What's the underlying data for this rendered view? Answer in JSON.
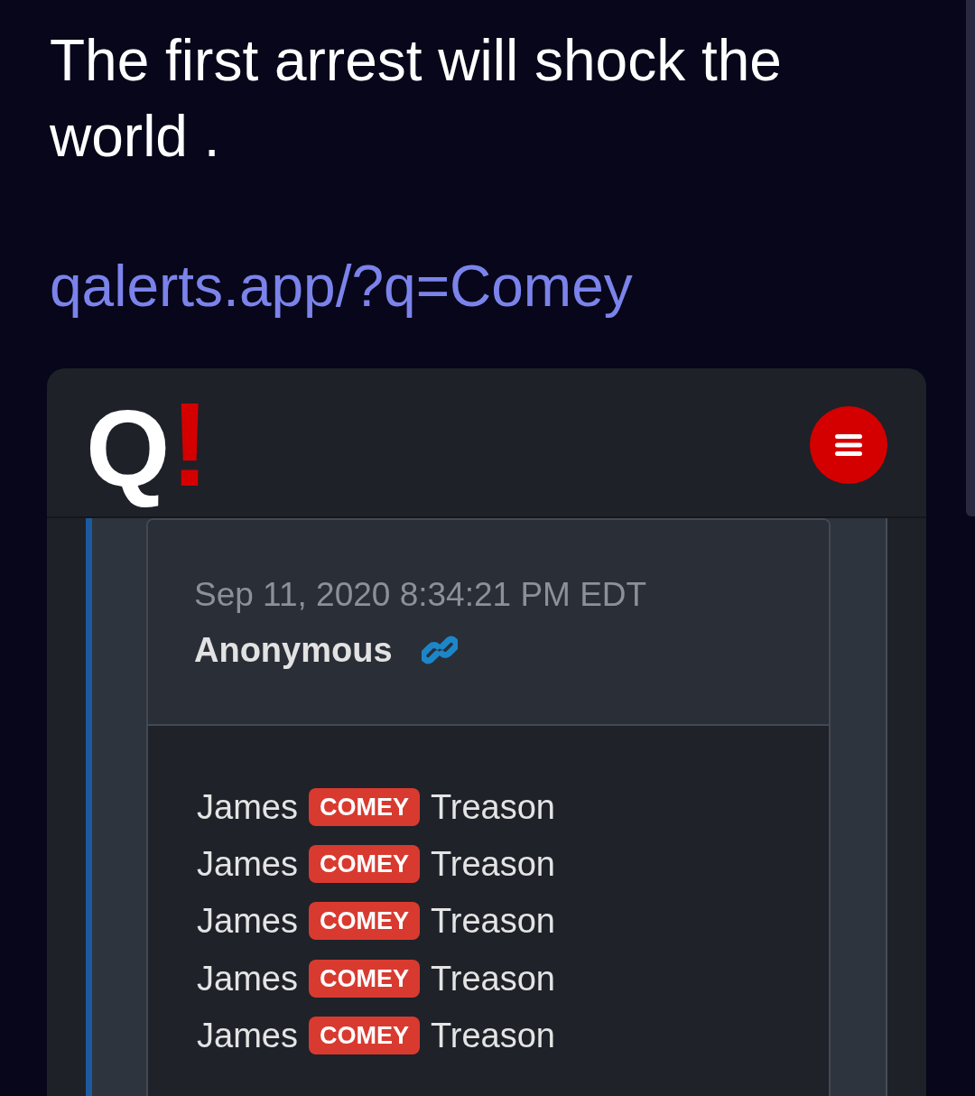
{
  "post": {
    "text": "The first arrest will shock the world .",
    "link": "qalerts.app/?q=Comey"
  },
  "embed": {
    "logo": {
      "letter": "Q",
      "mark": "!"
    },
    "drop": {
      "date": "Sep 11, 2020 8:34:21 PM EDT",
      "author": "Anonymous",
      "lines": [
        {
          "before": "James",
          "tag": "COMEY",
          "after": "Treason"
        },
        {
          "before": "James",
          "tag": "COMEY",
          "after": "Treason"
        },
        {
          "before": "James",
          "tag": "COMEY",
          "after": "Treason"
        },
        {
          "before": "James",
          "tag": "COMEY",
          "after": "Treason"
        },
        {
          "before": "James",
          "tag": "COMEY",
          "after": "Treason"
        }
      ]
    }
  }
}
